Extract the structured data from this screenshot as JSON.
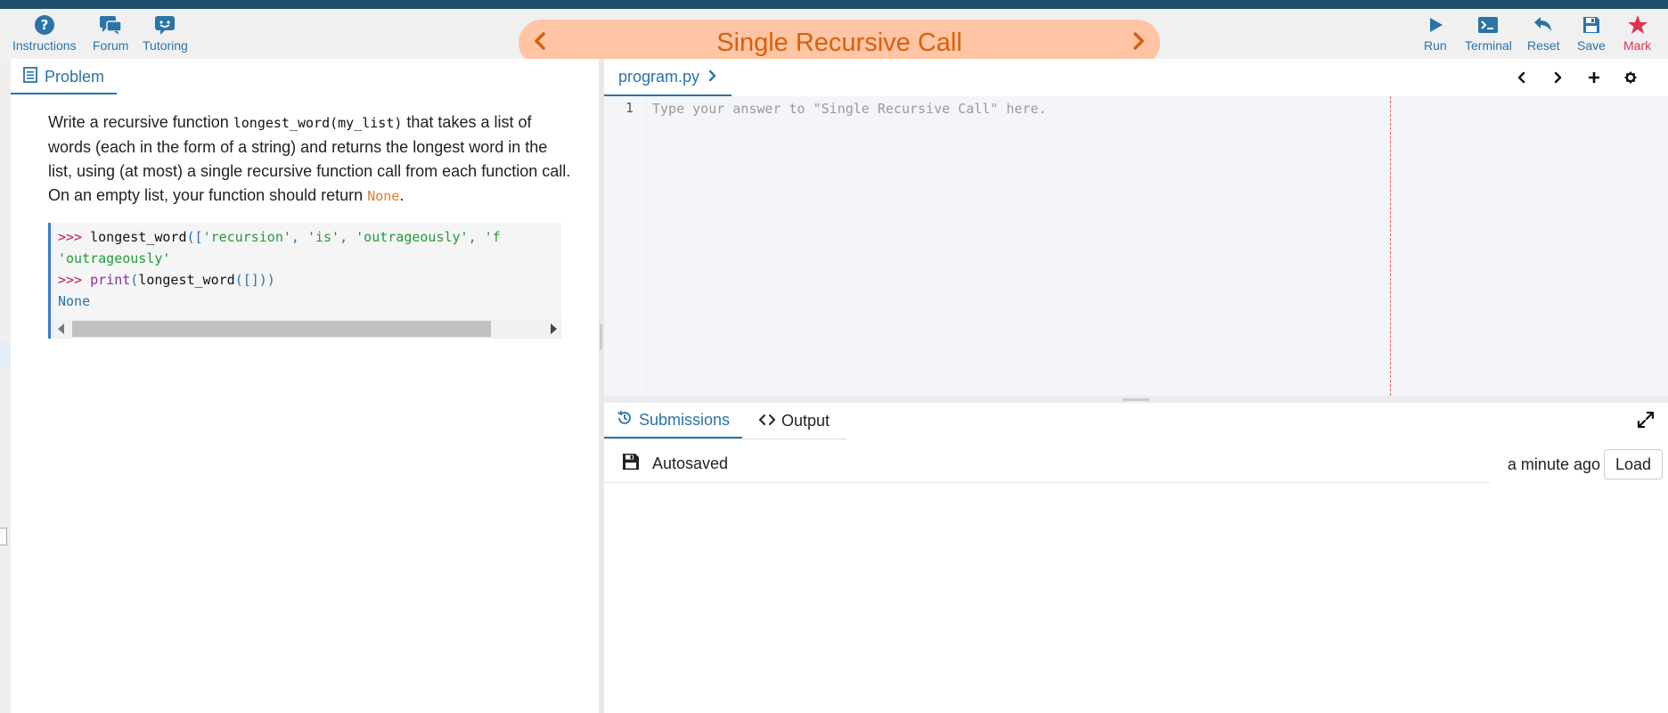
{
  "toolbar": {
    "left": [
      {
        "label": "Instructions",
        "icon": "question-circle-icon"
      },
      {
        "label": "Forum",
        "icon": "chat-bubbles-icon"
      },
      {
        "label": "Tutoring",
        "icon": "tutor-chat-icon"
      }
    ],
    "right": [
      {
        "label": "Run",
        "icon": "play-icon"
      },
      {
        "label": "Terminal",
        "icon": "terminal-icon"
      },
      {
        "label": "Reset",
        "icon": "undo-icon"
      },
      {
        "label": "Save",
        "icon": "floppy-icon"
      },
      {
        "label": "Mark",
        "icon": "star-icon"
      }
    ],
    "title": "Single Recursive Call",
    "accent": "#2a74a8",
    "title_color": "#d9600c",
    "pill_color": "#ffc5a4"
  },
  "problem": {
    "tab_label": "Problem",
    "desc_1": "Write a recursive function ",
    "func_sig": "longest_word(my_list)",
    "desc_2": " that takes a list of words (each in the form of a string) and returns the longest word in the list, using (at most) a single recursive function call from each function call. On an empty list, your function should return ",
    "none_code": "None",
    "desc_3": ".",
    "code": {
      "prompt": ">>>",
      "line1_fn": "longest_word",
      "line1_open": "([",
      "s1": "'recursion'",
      "comma": ", ",
      "s2": "'is'",
      "s3": "'outrageously'",
      "s4": "'f",
      "line2": "'outrageously'",
      "line3_fn": "print",
      "line3_inner": "longest_word",
      "line3_args": "([]))",
      "line4": "None"
    }
  },
  "editor": {
    "file_tab": "program.py",
    "line_number": "1",
    "placeholder": "Type your answer to \"Single Recursive Call\" here."
  },
  "bottom": {
    "tabs": [
      {
        "label": "Submissions",
        "active": true
      },
      {
        "label": "Output",
        "active": false
      }
    ],
    "status": "Autosaved",
    "time": "a minute ago",
    "load_label": "Load"
  }
}
